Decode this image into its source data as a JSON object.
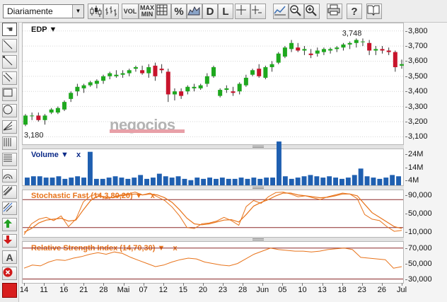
{
  "toolbar": {
    "period_value": "Diariamente",
    "vol_label": "VOL",
    "maxmin_label": "MAX\nMIN",
    "percent_label": "%",
    "d_label": "D",
    "l_label": "L",
    "help_label": "?"
  },
  "sidebar": {
    "text_label": "A"
  },
  "watermark": "negocios",
  "colors": {
    "up_candle": "#1ea81e",
    "down_candle": "#c8142c",
    "volume_bar": "#1f5fb0",
    "oscillator": "#e8731a",
    "ref_line": "#8b2a2a",
    "title_blue": "#0b2a88",
    "title_orange": "#e8731a"
  },
  "chart_data": [
    {
      "type": "candlestick",
      "panel": "price",
      "title": "EDP",
      "annotations": {
        "max_label": "3,748",
        "min_label": "3,180"
      },
      "ylim": [
        3.05,
        3.85
      ],
      "y_ticks": [
        3.1,
        3.2,
        3.3,
        3.4,
        3.5,
        3.6,
        3.7,
        3.8
      ],
      "y_tick_labels": [
        "3,100",
        "3,200",
        "3,300",
        "3,400",
        "3,500",
        "3,600",
        "3,700",
        "3,800"
      ],
      "grid": true,
      "candles": [
        [
          3.18,
          3.25,
          3.17,
          3.24
        ],
        [
          3.24,
          3.26,
          3.21,
          3.24
        ],
        [
          3.24,
          3.26,
          3.2,
          3.21
        ],
        [
          3.21,
          3.25,
          3.18,
          3.24
        ],
        [
          3.26,
          3.29,
          3.25,
          3.28
        ],
        [
          3.26,
          3.3,
          3.25,
          3.29
        ],
        [
          3.28,
          3.34,
          3.27,
          3.33
        ],
        [
          3.35,
          3.4,
          3.33,
          3.39
        ],
        [
          3.4,
          3.45,
          3.37,
          3.43
        ],
        [
          3.42,
          3.45,
          3.39,
          3.44
        ],
        [
          3.44,
          3.47,
          3.43,
          3.46
        ],
        [
          3.45,
          3.48,
          3.42,
          3.47
        ],
        [
          3.47,
          3.51,
          3.45,
          3.5
        ],
        [
          3.5,
          3.53,
          3.48,
          3.52
        ],
        [
          3.5,
          3.54,
          3.49,
          3.51
        ],
        [
          3.51,
          3.54,
          3.49,
          3.52
        ],
        [
          3.52,
          3.55,
          3.5,
          3.54
        ],
        [
          3.55,
          3.57,
          3.53,
          3.56
        ],
        [
          3.54,
          3.57,
          3.51,
          3.52
        ],
        [
          3.52,
          3.58,
          3.49,
          3.56
        ],
        [
          3.57,
          3.59,
          3.47,
          3.5
        ],
        [
          3.55,
          3.58,
          3.52,
          3.54
        ],
        [
          3.53,
          3.55,
          3.33,
          3.38
        ],
        [
          3.38,
          3.42,
          3.34,
          3.4
        ],
        [
          3.4,
          3.42,
          3.35,
          3.37
        ],
        [
          3.4,
          3.44,
          3.38,
          3.43
        ],
        [
          3.42,
          3.45,
          3.4,
          3.43
        ],
        [
          3.42,
          3.45,
          3.41,
          3.44
        ],
        [
          3.45,
          3.52,
          3.43,
          3.5
        ],
        [
          3.5,
          3.57,
          3.49,
          3.56
        ],
        [
          3.37,
          3.42,
          3.36,
          3.41
        ],
        [
          3.41,
          3.44,
          3.39,
          3.42
        ],
        [
          3.4,
          3.43,
          3.37,
          3.39
        ],
        [
          3.4,
          3.46,
          3.38,
          3.45
        ],
        [
          3.44,
          3.51,
          3.43,
          3.49
        ],
        [
          3.51,
          3.55,
          3.5,
          3.54
        ],
        [
          3.55,
          3.58,
          3.49,
          3.5
        ],
        [
          3.49,
          3.57,
          3.48,
          3.56
        ],
        [
          3.56,
          3.6,
          3.53,
          3.58
        ],
        [
          3.59,
          3.66,
          3.58,
          3.65
        ],
        [
          3.63,
          3.7,
          3.62,
          3.69
        ],
        [
          3.68,
          3.74,
          3.66,
          3.72
        ],
        [
          3.69,
          3.72,
          3.66,
          3.67
        ],
        [
          3.67,
          3.7,
          3.64,
          3.68
        ],
        [
          3.65,
          3.68,
          3.62,
          3.64
        ],
        [
          3.65,
          3.69,
          3.63,
          3.67
        ],
        [
          3.66,
          3.69,
          3.64,
          3.68
        ],
        [
          3.67,
          3.69,
          3.65,
          3.68
        ],
        [
          3.68,
          3.7,
          3.66,
          3.69
        ],
        [
          3.69,
          3.72,
          3.67,
          3.71
        ],
        [
          3.71,
          3.73,
          3.68,
          3.72
        ],
        [
          3.72,
          3.75,
          3.69,
          3.74
        ],
        [
          3.73,
          3.75,
          3.7,
          3.73
        ],
        [
          3.72,
          3.74,
          3.64,
          3.67
        ],
        [
          3.67,
          3.7,
          3.64,
          3.68
        ],
        [
          3.68,
          3.7,
          3.65,
          3.67
        ],
        [
          3.67,
          3.69,
          3.64,
          3.66
        ],
        [
          3.66,
          3.67,
          3.53,
          3.56
        ],
        [
          3.57,
          3.61,
          3.55,
          3.58
        ]
      ]
    },
    {
      "type": "bar",
      "panel": "volume",
      "title": "Volume",
      "ylim": [
        0,
        28
      ],
      "y_ticks": [
        4,
        14,
        24
      ],
      "y_tick_labels": [
        "4M",
        "14M",
        "24M"
      ],
      "values": [
        6,
        7,
        7,
        6,
        6,
        7,
        5,
        6,
        7,
        6,
        26,
        5,
        5,
        6,
        7,
        6,
        5,
        6,
        8,
        5,
        6,
        9,
        7,
        6,
        7,
        5,
        4,
        6,
        5,
        6,
        5,
        6,
        5,
        5,
        6,
        5,
        6,
        5,
        6,
        6,
        34,
        7,
        5,
        6,
        7,
        8,
        7,
        6,
        7,
        6,
        5,
        6,
        8,
        13,
        7,
        6,
        5,
        6,
        8,
        7
      ]
    },
    {
      "type": "line",
      "panel": "stochastic",
      "title": "Stochastic Fast (14,3,80,20)",
      "ylim": [
        0,
        100
      ],
      "y_ticks": [
        10,
        50,
        90
      ],
      "y_tick_labels": [
        "10,000",
        "50,000",
        "90,000"
      ],
      "reference_lines": [
        80,
        20
      ],
      "series": [
        {
          "values": [
            5,
            28,
            38,
            42,
            35,
            45,
            22,
            38,
            75,
            88,
            92,
            82,
            85,
            90,
            92,
            96,
            90,
            94,
            86,
            78,
            64,
            45,
            20,
            18,
            28,
            30,
            34,
            42,
            35,
            25,
            65,
            78,
            72,
            86,
            95,
            96,
            92,
            86,
            88,
            84,
            80,
            86,
            90,
            94,
            92,
            82,
            48,
            38,
            35,
            22,
            12,
            14
          ]
        },
        {
          "values": [
            10,
            18,
            30,
            36,
            38,
            40,
            34,
            36,
            58,
            78,
            88,
            86,
            84,
            88,
            90,
            92,
            90,
            92,
            90,
            84,
            74,
            58,
            40,
            28,
            26,
            28,
            32,
            36,
            37,
            32,
            48,
            66,
            74,
            80,
            88,
            94,
            94,
            90,
            88,
            86,
            84,
            85,
            88,
            92,
            92,
            88,
            70,
            52,
            42,
            32,
            22,
            18
          ]
        }
      ]
    },
    {
      "type": "line",
      "panel": "rsi",
      "title": "Relative Strength Index (14,70,30)",
      "ylim": [
        25,
        78
      ],
      "y_ticks": [
        30,
        50,
        70
      ],
      "y_tick_labels": [
        "30,000",
        "50,000",
        "70,000"
      ],
      "reference_lines": [
        70,
        30
      ],
      "series": [
        {
          "values": [
            44,
            48,
            47,
            52,
            55,
            54,
            57,
            59,
            62,
            64,
            62,
            65,
            63,
            58,
            54,
            50,
            46,
            48,
            52,
            55,
            57,
            56,
            52,
            50,
            48,
            47,
            50,
            56,
            62,
            66,
            70,
            68,
            67,
            66,
            66,
            65,
            66,
            68,
            69,
            70,
            68,
            58,
            57,
            56,
            55,
            44,
            46
          ]
        }
      ]
    }
  ],
  "x_axis": {
    "labels": [
      "14",
      "11",
      "16",
      "21",
      "28",
      "Mai",
      "07",
      "12",
      "15",
      "20",
      "23",
      "28",
      "Jun",
      "05",
      "10",
      "13",
      "18",
      "23",
      "26",
      "Jul"
    ]
  }
}
